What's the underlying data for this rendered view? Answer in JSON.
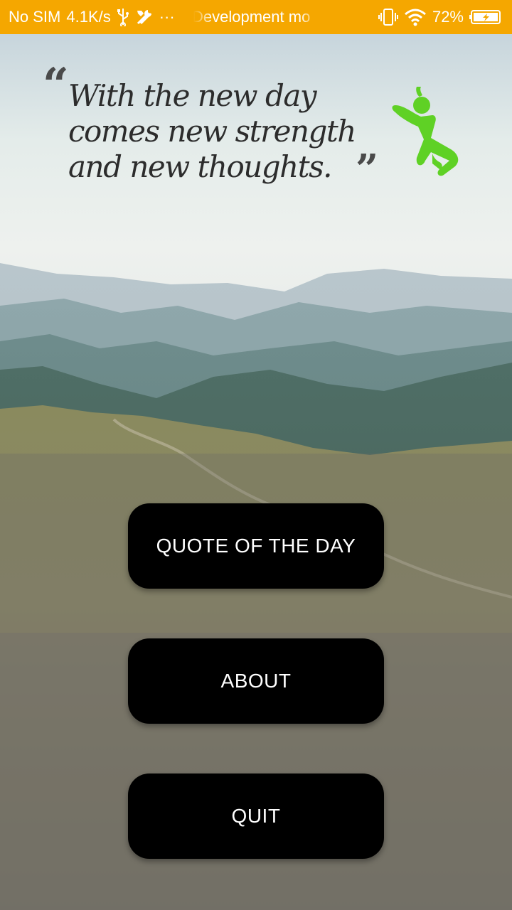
{
  "status_bar": {
    "carrier": "No SIM",
    "speed": "4.1K/s",
    "more": "···",
    "ticker": "Development mo",
    "battery": "72%",
    "bar_color": "#f5a700",
    "icons": [
      "usb-icon",
      "tools-icon",
      "vibrate-icon",
      "wifi-icon",
      "battery-charging-icon"
    ]
  },
  "quote": {
    "text": "With the new day comes new strength and new thoughts.",
    "open_mark": "“",
    "close_mark": "”",
    "runner_color": "#5fd125"
  },
  "menu": {
    "quote_of_the_day": "QUOTE OF THE DAY",
    "about": "ABOUT",
    "quit": "QUIT"
  }
}
